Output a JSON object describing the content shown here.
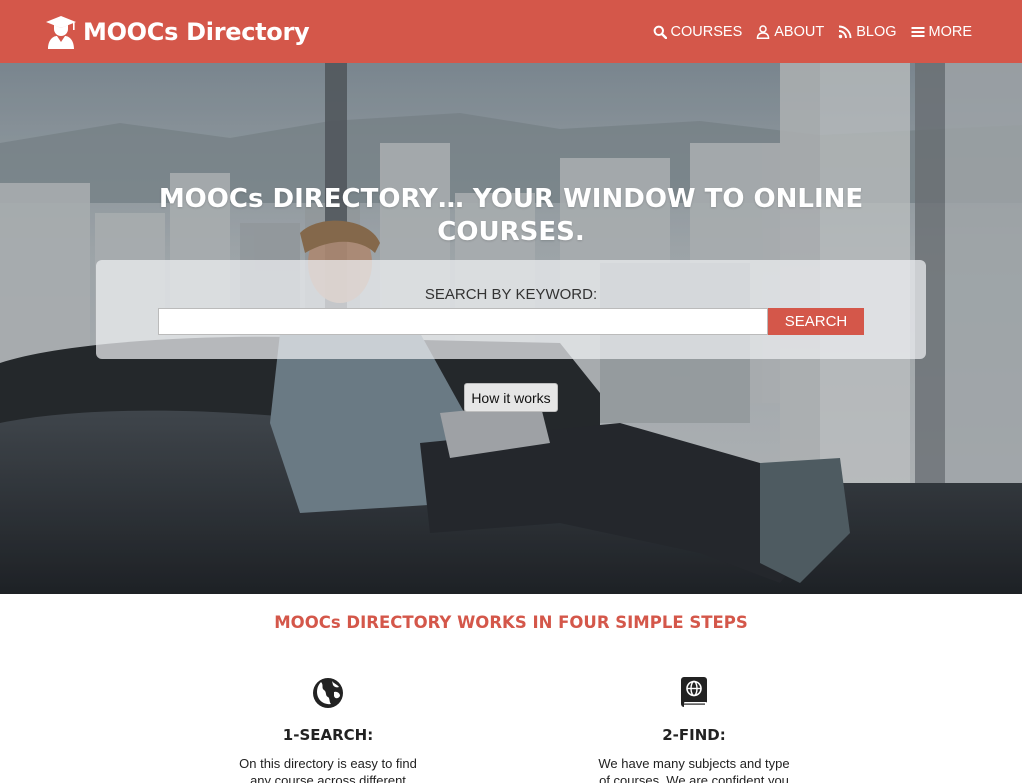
{
  "brand": {
    "name": "MOOCs Directory",
    "icon": "graduate-icon"
  },
  "nav": {
    "items": [
      {
        "label": "COURSES",
        "icon": "search-icon"
      },
      {
        "label": "ABOUT",
        "icon": "user-icon"
      },
      {
        "label": "BLOG",
        "icon": "rss-icon"
      },
      {
        "label": "MORE",
        "icon": "menu-icon"
      }
    ]
  },
  "hero": {
    "title": "MOOCs DIRECTORY… YOUR WINDOW TO ONLINE COURSES.",
    "search_label": "SEARCH BY KEYWORD:",
    "search_value": "",
    "search_placeholder": "",
    "search_button": "SEARCH",
    "how_button": "How it works"
  },
  "steps": {
    "title": "MOOCs DIRECTORY WORKS IN FOUR SIMPLE STEPS",
    "items": [
      {
        "icon": "globe-icon",
        "heading": "1-SEARCH:",
        "text": "On this directory is easy to find any course across different"
      },
      {
        "icon": "book-icon",
        "heading": "2-FIND:",
        "text": "We have many subjects and type of courses. We are confident you"
      }
    ]
  },
  "colors": {
    "accent": "#d4574a",
    "white": "#ffffff"
  }
}
